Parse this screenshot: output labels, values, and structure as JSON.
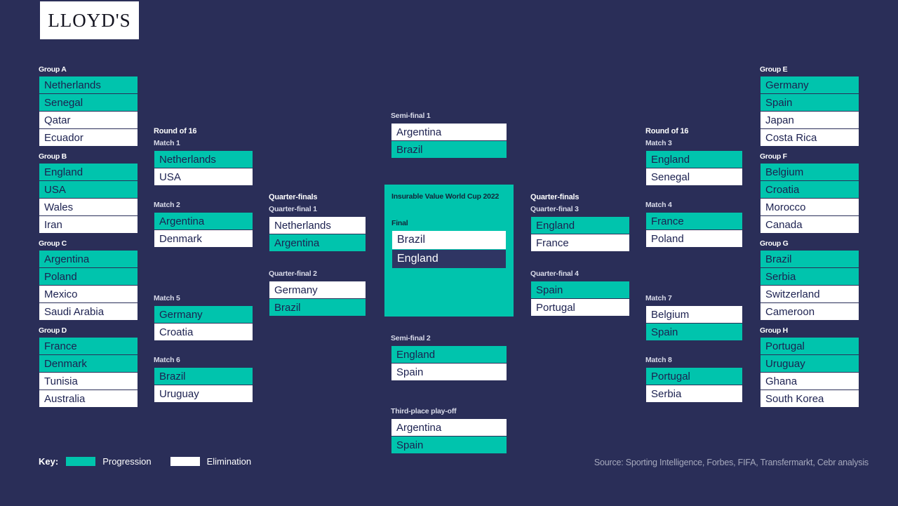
{
  "brand": {
    "logo_text": "LLOYD'S"
  },
  "colors": {
    "background": "#2a2e58",
    "progression": "#00c4ad",
    "elimination": "#ffffff",
    "champion": "#2f3563"
  },
  "groups_left": [
    {
      "title": "Group A",
      "teams": [
        {
          "name": "Netherlands",
          "status": "Progression"
        },
        {
          "name": "Senegal",
          "status": "Progression"
        },
        {
          "name": "Qatar",
          "status": "Elimination"
        },
        {
          "name": "Ecuador",
          "status": "Elimination"
        }
      ]
    },
    {
      "title": "Group B",
      "teams": [
        {
          "name": "England",
          "status": "Progression"
        },
        {
          "name": "USA",
          "status": "Progression"
        },
        {
          "name": "Wales",
          "status": "Elimination"
        },
        {
          "name": "Iran",
          "status": "Elimination"
        }
      ]
    },
    {
      "title": "Group C",
      "teams": [
        {
          "name": "Argentina",
          "status": "Progression"
        },
        {
          "name": "Poland",
          "status": "Progression"
        },
        {
          "name": "Mexico",
          "status": "Elimination"
        },
        {
          "name": "Saudi Arabia",
          "status": "Elimination"
        }
      ]
    },
    {
      "title": "Group D",
      "teams": [
        {
          "name": "France",
          "status": "Progression"
        },
        {
          "name": "Denmark",
          "status": "Progression"
        },
        {
          "name": "Tunisia",
          "status": "Elimination"
        },
        {
          "name": "Australia",
          "status": "Elimination"
        }
      ]
    }
  ],
  "groups_right": [
    {
      "title": "Group E",
      "teams": [
        {
          "name": "Germany",
          "status": "Progression"
        },
        {
          "name": "Spain",
          "status": "Progression"
        },
        {
          "name": "Japan",
          "status": "Elimination"
        },
        {
          "name": "Costa Rica",
          "status": "Elimination"
        }
      ]
    },
    {
      "title": "Group F",
      "teams": [
        {
          "name": "Belgium",
          "status": "Progression"
        },
        {
          "name": "Croatia",
          "status": "Progression"
        },
        {
          "name": "Morocco",
          "status": "Elimination"
        },
        {
          "name": "Canada",
          "status": "Elimination"
        }
      ]
    },
    {
      "title": "Group G",
      "teams": [
        {
          "name": "Brazil",
          "status": "Progression"
        },
        {
          "name": "Serbia",
          "status": "Progression"
        },
        {
          "name": "Switzerland",
          "status": "Elimination"
        },
        {
          "name": "Cameroon",
          "status": "Elimination"
        }
      ]
    },
    {
      "title": "Group H",
      "teams": [
        {
          "name": "Portugal",
          "status": "Progression"
        },
        {
          "name": "Uruguay",
          "status": "Progression"
        },
        {
          "name": "Ghana",
          "status": "Elimination"
        },
        {
          "name": "South Korea",
          "status": "Elimination"
        }
      ]
    }
  ],
  "r16_left": {
    "stage": "Round of 16",
    "matches": [
      {
        "label": "Match 1",
        "teams": [
          {
            "name": "Netherlands",
            "status": "Progression"
          },
          {
            "name": "USA",
            "status": "Elimination"
          }
        ]
      },
      {
        "label": "Match 2",
        "teams": [
          {
            "name": "Argentina",
            "status": "Progression"
          },
          {
            "name": "Denmark",
            "status": "Elimination"
          }
        ]
      },
      {
        "label": "Match 5",
        "teams": [
          {
            "name": "Germany",
            "status": "Progression"
          },
          {
            "name": "Croatia",
            "status": "Elimination"
          }
        ]
      },
      {
        "label": "Match 6",
        "teams": [
          {
            "name": "Brazil",
            "status": "Progression"
          },
          {
            "name": "Uruguay",
            "status": "Elimination"
          }
        ]
      }
    ]
  },
  "r16_right": {
    "stage": "Round of 16",
    "matches": [
      {
        "label": "Match 3",
        "teams": [
          {
            "name": "England",
            "status": "Progression"
          },
          {
            "name": "Senegal",
            "status": "Elimination"
          }
        ]
      },
      {
        "label": "Match 4",
        "teams": [
          {
            "name": "France",
            "status": "Progression"
          },
          {
            "name": "Poland",
            "status": "Elimination"
          }
        ]
      },
      {
        "label": "Match 7",
        "teams": [
          {
            "name": "Belgium",
            "status": "Elimination"
          },
          {
            "name": "Spain",
            "status": "Progression"
          }
        ]
      },
      {
        "label": "Match 8",
        "teams": [
          {
            "name": "Portugal",
            "status": "Progression"
          },
          {
            "name": "Serbia",
            "status": "Elimination"
          }
        ]
      }
    ]
  },
  "qf_left": {
    "stage": "Quarter-finals",
    "matches": [
      {
        "label": "Quarter-final 1",
        "teams": [
          {
            "name": "Netherlands",
            "status": "Elimination"
          },
          {
            "name": "Argentina",
            "status": "Progression"
          }
        ]
      },
      {
        "label": "Quarter-final 2",
        "teams": [
          {
            "name": "Germany",
            "status": "Elimination"
          },
          {
            "name": "Brazil",
            "status": "Progression"
          }
        ]
      }
    ]
  },
  "qf_right": {
    "stage": "Quarter-finals",
    "matches": [
      {
        "label": "Quarter-final 3",
        "teams": [
          {
            "name": "England",
            "status": "Progression"
          },
          {
            "name": "France",
            "status": "Elimination"
          }
        ]
      },
      {
        "label": "Quarter-final 4",
        "teams": [
          {
            "name": "Spain",
            "status": "Progression"
          },
          {
            "name": "Portugal",
            "status": "Elimination"
          }
        ]
      }
    ]
  },
  "semi_final_1": {
    "label": "Semi-final 1",
    "teams": [
      {
        "name": "Argentina",
        "status": "Elimination"
      },
      {
        "name": "Brazil",
        "status": "Progression"
      }
    ]
  },
  "semi_final_2": {
    "label": "Semi-final 2",
    "teams": [
      {
        "name": "England",
        "status": "Progression"
      },
      {
        "name": "Spain",
        "status": "Elimination"
      }
    ]
  },
  "third_place": {
    "label": "Third-place play-off",
    "teams": [
      {
        "name": "Argentina",
        "status": "Elimination"
      },
      {
        "name": "Spain",
        "status": "Progression"
      }
    ]
  },
  "final": {
    "panel_title": "Insurable Value World Cup 2022",
    "label": "Final",
    "teams": [
      {
        "name": "Brazil",
        "status": "Elimination"
      },
      {
        "name": "England",
        "status": "Champion"
      }
    ]
  },
  "key": {
    "label": "Key:",
    "progression": "Progression",
    "elimination": "Elimination"
  },
  "source": "Source: Sporting Intelligence, Forbes, FIFA, Transfermarkt, Cebr analysis"
}
